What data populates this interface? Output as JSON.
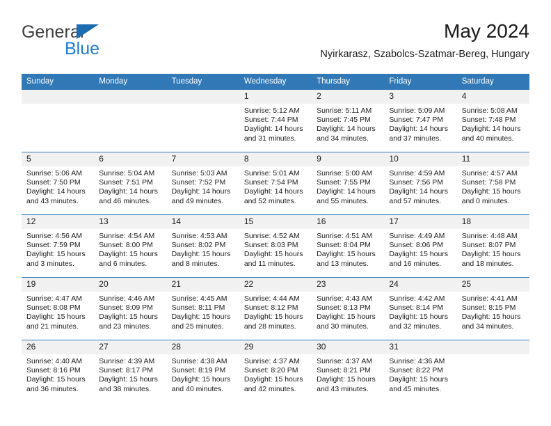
{
  "brand": {
    "line1": "General",
    "line2": "Blue",
    "triangle_color": "#1b6cb0",
    "blue_color": "#1b7ad1"
  },
  "header": {
    "title": "May 2024",
    "subtitle": "Nyirkarasz, Szabolcs-Szatmar-Bereg, Hungary"
  },
  "theme": {
    "header_blue": "#3178b6",
    "daynum_bg": "#f1f1f1",
    "text": "#1a1a1a"
  },
  "weekday_headers": [
    "Sunday",
    "Monday",
    "Tuesday",
    "Wednesday",
    "Thursday",
    "Friday",
    "Saturday"
  ],
  "labels": {
    "sunrise_prefix": "Sunrise:",
    "sunset_prefix": "Sunset:",
    "daylight_prefix": "Daylight:"
  },
  "weeks": [
    [
      {
        "day": "",
        "empty": true
      },
      {
        "day": "",
        "empty": true
      },
      {
        "day": "",
        "empty": true
      },
      {
        "day": "1",
        "sunrise": "Sunrise: 5:12 AM",
        "sunset": "Sunset: 7:44 PM",
        "daylight_l1": "Daylight: 14 hours",
        "daylight_l2": "and 31 minutes."
      },
      {
        "day": "2",
        "sunrise": "Sunrise: 5:11 AM",
        "sunset": "Sunset: 7:45 PM",
        "daylight_l1": "Daylight: 14 hours",
        "daylight_l2": "and 34 minutes."
      },
      {
        "day": "3",
        "sunrise": "Sunrise: 5:09 AM",
        "sunset": "Sunset: 7:47 PM",
        "daylight_l1": "Daylight: 14 hours",
        "daylight_l2": "and 37 minutes."
      },
      {
        "day": "4",
        "sunrise": "Sunrise: 5:08 AM",
        "sunset": "Sunset: 7:48 PM",
        "daylight_l1": "Daylight: 14 hours",
        "daylight_l2": "and 40 minutes."
      }
    ],
    [
      {
        "day": "5",
        "sunrise": "Sunrise: 5:06 AM",
        "sunset": "Sunset: 7:50 PM",
        "daylight_l1": "Daylight: 14 hours",
        "daylight_l2": "and 43 minutes."
      },
      {
        "day": "6",
        "sunrise": "Sunrise: 5:04 AM",
        "sunset": "Sunset: 7:51 PM",
        "daylight_l1": "Daylight: 14 hours",
        "daylight_l2": "and 46 minutes."
      },
      {
        "day": "7",
        "sunrise": "Sunrise: 5:03 AM",
        "sunset": "Sunset: 7:52 PM",
        "daylight_l1": "Daylight: 14 hours",
        "daylight_l2": "and 49 minutes."
      },
      {
        "day": "8",
        "sunrise": "Sunrise: 5:01 AM",
        "sunset": "Sunset: 7:54 PM",
        "daylight_l1": "Daylight: 14 hours",
        "daylight_l2": "and 52 minutes."
      },
      {
        "day": "9",
        "sunrise": "Sunrise: 5:00 AM",
        "sunset": "Sunset: 7:55 PM",
        "daylight_l1": "Daylight: 14 hours",
        "daylight_l2": "and 55 minutes."
      },
      {
        "day": "10",
        "sunrise": "Sunrise: 4:59 AM",
        "sunset": "Sunset: 7:56 PM",
        "daylight_l1": "Daylight: 14 hours",
        "daylight_l2": "and 57 minutes."
      },
      {
        "day": "11",
        "sunrise": "Sunrise: 4:57 AM",
        "sunset": "Sunset: 7:58 PM",
        "daylight_l1": "Daylight: 15 hours",
        "daylight_l2": "and 0 minutes."
      }
    ],
    [
      {
        "day": "12",
        "sunrise": "Sunrise: 4:56 AM",
        "sunset": "Sunset: 7:59 PM",
        "daylight_l1": "Daylight: 15 hours",
        "daylight_l2": "and 3 minutes."
      },
      {
        "day": "13",
        "sunrise": "Sunrise: 4:54 AM",
        "sunset": "Sunset: 8:00 PM",
        "daylight_l1": "Daylight: 15 hours",
        "daylight_l2": "and 6 minutes."
      },
      {
        "day": "14",
        "sunrise": "Sunrise: 4:53 AM",
        "sunset": "Sunset: 8:02 PM",
        "daylight_l1": "Daylight: 15 hours",
        "daylight_l2": "and 8 minutes."
      },
      {
        "day": "15",
        "sunrise": "Sunrise: 4:52 AM",
        "sunset": "Sunset: 8:03 PM",
        "daylight_l1": "Daylight: 15 hours",
        "daylight_l2": "and 11 minutes."
      },
      {
        "day": "16",
        "sunrise": "Sunrise: 4:51 AM",
        "sunset": "Sunset: 8:04 PM",
        "daylight_l1": "Daylight: 15 hours",
        "daylight_l2": "and 13 minutes."
      },
      {
        "day": "17",
        "sunrise": "Sunrise: 4:49 AM",
        "sunset": "Sunset: 8:06 PM",
        "daylight_l1": "Daylight: 15 hours",
        "daylight_l2": "and 16 minutes."
      },
      {
        "day": "18",
        "sunrise": "Sunrise: 4:48 AM",
        "sunset": "Sunset: 8:07 PM",
        "daylight_l1": "Daylight: 15 hours",
        "daylight_l2": "and 18 minutes."
      }
    ],
    [
      {
        "day": "19",
        "sunrise": "Sunrise: 4:47 AM",
        "sunset": "Sunset: 8:08 PM",
        "daylight_l1": "Daylight: 15 hours",
        "daylight_l2": "and 21 minutes."
      },
      {
        "day": "20",
        "sunrise": "Sunrise: 4:46 AM",
        "sunset": "Sunset: 8:09 PM",
        "daylight_l1": "Daylight: 15 hours",
        "daylight_l2": "and 23 minutes."
      },
      {
        "day": "21",
        "sunrise": "Sunrise: 4:45 AM",
        "sunset": "Sunset: 8:11 PM",
        "daylight_l1": "Daylight: 15 hours",
        "daylight_l2": "and 25 minutes."
      },
      {
        "day": "22",
        "sunrise": "Sunrise: 4:44 AM",
        "sunset": "Sunset: 8:12 PM",
        "daylight_l1": "Daylight: 15 hours",
        "daylight_l2": "and 28 minutes."
      },
      {
        "day": "23",
        "sunrise": "Sunrise: 4:43 AM",
        "sunset": "Sunset: 8:13 PM",
        "daylight_l1": "Daylight: 15 hours",
        "daylight_l2": "and 30 minutes."
      },
      {
        "day": "24",
        "sunrise": "Sunrise: 4:42 AM",
        "sunset": "Sunset: 8:14 PM",
        "daylight_l1": "Daylight: 15 hours",
        "daylight_l2": "and 32 minutes."
      },
      {
        "day": "25",
        "sunrise": "Sunrise: 4:41 AM",
        "sunset": "Sunset: 8:15 PM",
        "daylight_l1": "Daylight: 15 hours",
        "daylight_l2": "and 34 minutes."
      }
    ],
    [
      {
        "day": "26",
        "sunrise": "Sunrise: 4:40 AM",
        "sunset": "Sunset: 8:16 PM",
        "daylight_l1": "Daylight: 15 hours",
        "daylight_l2": "and 36 minutes."
      },
      {
        "day": "27",
        "sunrise": "Sunrise: 4:39 AM",
        "sunset": "Sunset: 8:17 PM",
        "daylight_l1": "Daylight: 15 hours",
        "daylight_l2": "and 38 minutes."
      },
      {
        "day": "28",
        "sunrise": "Sunrise: 4:38 AM",
        "sunset": "Sunset: 8:19 PM",
        "daylight_l1": "Daylight: 15 hours",
        "daylight_l2": "and 40 minutes."
      },
      {
        "day": "29",
        "sunrise": "Sunrise: 4:37 AM",
        "sunset": "Sunset: 8:20 PM",
        "daylight_l1": "Daylight: 15 hours",
        "daylight_l2": "and 42 minutes."
      },
      {
        "day": "30",
        "sunrise": "Sunrise: 4:37 AM",
        "sunset": "Sunset: 8:21 PM",
        "daylight_l1": "Daylight: 15 hours",
        "daylight_l2": "and 43 minutes."
      },
      {
        "day": "31",
        "sunrise": "Sunrise: 4:36 AM",
        "sunset": "Sunset: 8:22 PM",
        "daylight_l1": "Daylight: 15 hours",
        "daylight_l2": "and 45 minutes."
      },
      {
        "day": "",
        "empty": true
      }
    ]
  ]
}
